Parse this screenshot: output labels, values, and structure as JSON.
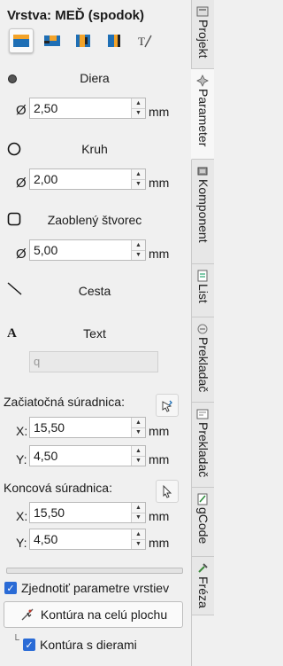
{
  "layer": {
    "title": "Vrstva: MEĎ (spodok)"
  },
  "toolbar": {
    "buttons": [
      "layer-top-icon",
      "layer-mid-icon",
      "layer-bottom-icon",
      "layer-side-icon",
      "layer-text-icon"
    ]
  },
  "hole": {
    "label": "Diera",
    "diameter_symbol": "Ø",
    "value": "2,50",
    "unit": "mm"
  },
  "circle": {
    "label": "Kruh",
    "diameter_symbol": "Ø",
    "value": "2,00",
    "unit": "mm"
  },
  "rounded_square": {
    "label": "Zaoblený štvorec",
    "diameter_symbol": "Ø",
    "value": "5,00",
    "unit": "mm"
  },
  "path": {
    "label": "Cesta"
  },
  "text": {
    "label": "Text",
    "symbol": "A",
    "placeholder": "q"
  },
  "start": {
    "label": "Začiatočná súradnica:",
    "x_label": "X:",
    "x_value": "15,50",
    "y_label": "Y:",
    "y_value": "4,50",
    "unit": "mm"
  },
  "end": {
    "label": "Koncová súradnica:",
    "x_label": "X:",
    "x_value": "15,50",
    "y_label": "Y:",
    "y_value": "4,50",
    "unit": "mm"
  },
  "progress": {
    "value": 0
  },
  "unify": {
    "label": "Zjednotiť parametre vrstiev",
    "checked": true
  },
  "contour_button": {
    "label": "Kontúra na celú plochu"
  },
  "contour_holes": {
    "tree_mark": "└",
    "label": "Kontúra s dierami",
    "checked": true
  },
  "tabs": [
    {
      "label": "Projekt",
      "icon": "project-icon"
    },
    {
      "label": "Parameter",
      "icon": "parameter-icon",
      "active": true
    },
    {
      "label": "Komponent",
      "icon": "component-icon"
    },
    {
      "label": "List",
      "icon": "list-icon"
    },
    {
      "label": "Prekladač",
      "icon": "translator-icon"
    },
    {
      "label": "Prekladač",
      "icon": "translator2-icon"
    },
    {
      "label": "gCode",
      "icon": "gcode-icon"
    },
    {
      "label": "Fréza",
      "icon": "mill-icon"
    }
  ],
  "colors": {
    "accent": "#2a6bd6",
    "copper": "#f2a32a",
    "layer_blue": "#1f6fb5"
  }
}
